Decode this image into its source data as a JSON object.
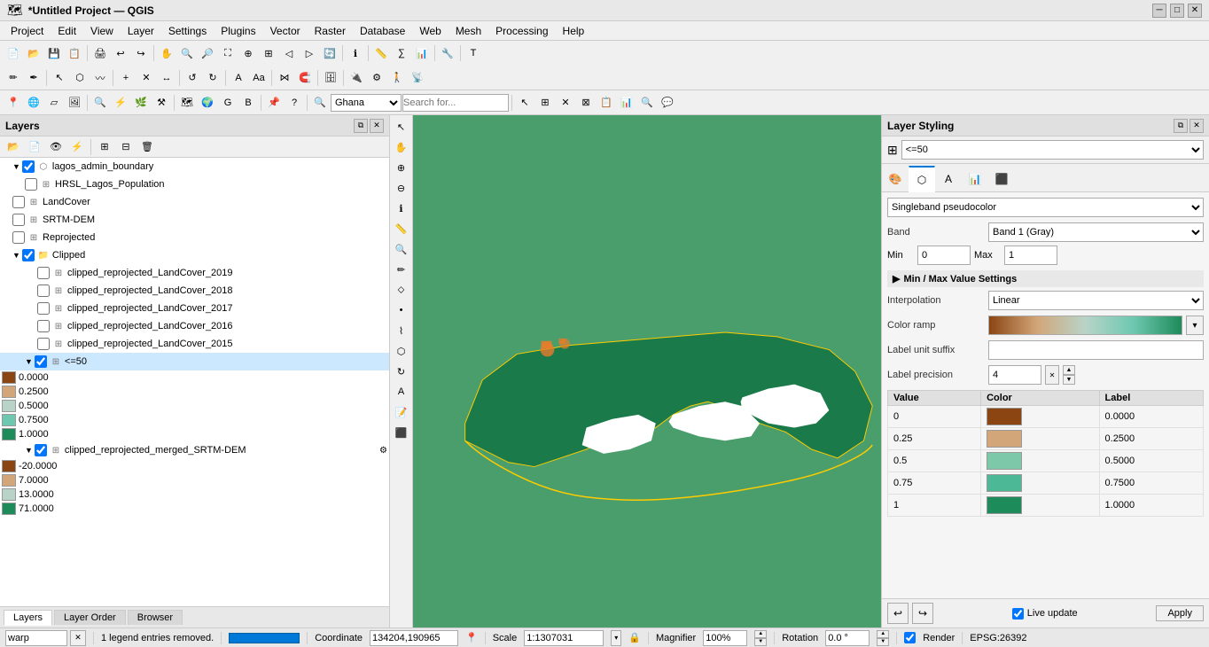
{
  "window": {
    "title": "*Untitled Project — QGIS"
  },
  "menubar": {
    "items": [
      "Project",
      "Edit",
      "View",
      "Layer",
      "Settings",
      "Plugins",
      "Vector",
      "Raster",
      "Database",
      "Web",
      "Mesh",
      "Processing",
      "Help"
    ]
  },
  "search": {
    "placeholder": "Search for...",
    "location": "Ghana"
  },
  "layers_panel": {
    "title": "Layers",
    "layers": [
      {
        "id": "lagos_admin_boundary",
        "label": "lagos_admin_boundary",
        "checked": true,
        "indent": 1,
        "type": "polygon"
      },
      {
        "id": "hrsl_lagos_population",
        "label": "HRSL_Lagos_Population",
        "checked": false,
        "indent": 2,
        "type": "raster"
      },
      {
        "id": "landcover",
        "label": "LandCover",
        "checked": false,
        "indent": 1,
        "type": "raster"
      },
      {
        "id": "srtm_dem",
        "label": "SRTM-DEM",
        "checked": false,
        "indent": 1,
        "type": "raster"
      },
      {
        "id": "reprojected",
        "label": "Reprojected",
        "checked": false,
        "indent": 1,
        "type": "raster"
      },
      {
        "id": "clipped_group",
        "label": "Clipped",
        "checked": true,
        "indent": 1,
        "type": "group",
        "expanded": true
      },
      {
        "id": "clipped_2019",
        "label": "clipped_reprojected_LandCover_2019",
        "checked": false,
        "indent": 3,
        "type": "raster"
      },
      {
        "id": "clipped_2018",
        "label": "clipped_reprojected_LandCover_2018",
        "checked": false,
        "indent": 3,
        "type": "raster"
      },
      {
        "id": "clipped_2017",
        "label": "clipped_reprojected_LandCover_2017",
        "checked": false,
        "indent": 3,
        "type": "raster"
      },
      {
        "id": "clipped_2016",
        "label": "clipped_reprojected_LandCover_2016",
        "checked": false,
        "indent": 3,
        "type": "raster"
      },
      {
        "id": "clipped_2015",
        "label": "clipped_reprojected_LandCover_2015",
        "checked": false,
        "indent": 3,
        "type": "raster"
      },
      {
        "id": "le50_group",
        "label": "<=50",
        "checked": true,
        "indent": 2,
        "type": "group",
        "expanded": true
      },
      {
        "id": "val_0",
        "label": "0.0000",
        "color": "#8B4513",
        "indent": 4
      },
      {
        "id": "val_025",
        "label": "0.2500",
        "color": "#D2A679",
        "indent": 4
      },
      {
        "id": "val_05",
        "label": "0.5000",
        "color": "#B8D4C8",
        "indent": 4
      },
      {
        "id": "val_075",
        "label": "0.7500",
        "color": "#8ECFB8",
        "indent": 4
      },
      {
        "id": "val_1",
        "label": "1.0000",
        "color": "#1E8B5A",
        "indent": 4
      },
      {
        "id": "merged_srtm",
        "label": "clipped_reprojected_merged_SRTM-DEM",
        "checked": true,
        "indent": 2,
        "type": "raster",
        "expanded": true
      },
      {
        "id": "val_neg20",
        "label": "-20.0000",
        "color": "#8B4513",
        "indent": 3
      },
      {
        "id": "val_7",
        "label": "7.0000",
        "color": "#D2A679",
        "indent": 3
      },
      {
        "id": "val_13",
        "label": "13.0000",
        "color": "#B8D4C8",
        "indent": 3
      },
      {
        "id": "val_71",
        "label": "71.0000",
        "color": "#1E8B5A",
        "indent": 3
      }
    ]
  },
  "bottom_tabs": [
    {
      "label": "Layers",
      "active": true
    },
    {
      "label": "Layer Order",
      "active": false
    },
    {
      "label": "Browser",
      "active": false
    }
  ],
  "styling_panel": {
    "title": "Layer Styling",
    "current_layer": "<=50",
    "renderer": "Singleband pseudocolor",
    "band": "Band 1 (Gray)",
    "min": "0",
    "max": "1",
    "min_max_section": "Min / Max Value Settings",
    "interpolation": "Linear",
    "color_ramp_label": "Color ramp",
    "label_unit_suffix": "",
    "label_precision": "4",
    "table_headers": [
      "Value",
      "Color",
      "Label"
    ],
    "table_rows": [
      {
        "value": "0",
        "color": "#8B4513",
        "label": "0.0000"
      },
      {
        "value": "0.25",
        "color": "#D2A679",
        "label": "0.2500"
      },
      {
        "value": "0.5",
        "color": "#7EC8AA",
        "label": "0.5000"
      },
      {
        "value": "0.75",
        "color": "#4DB896",
        "label": "0.7500"
      },
      {
        "value": "1",
        "color": "#1E8B5A",
        "label": "1.0000"
      }
    ],
    "live_update_label": "Live update",
    "apply_label": "Apply"
  },
  "statusbar": {
    "warp_label": "warp",
    "legend_msg": "1 legend entries removed.",
    "coordinate_label": "Coordinate",
    "coordinate_value": "134204,190965",
    "scale_label": "Scale",
    "scale_value": "1:1307031",
    "magnifier_label": "Magnifier",
    "magnifier_value": "100%",
    "rotation_label": "Rotation",
    "rotation_value": "0.0 °",
    "render_label": "Render",
    "epsg_label": "EPSG:26392"
  }
}
